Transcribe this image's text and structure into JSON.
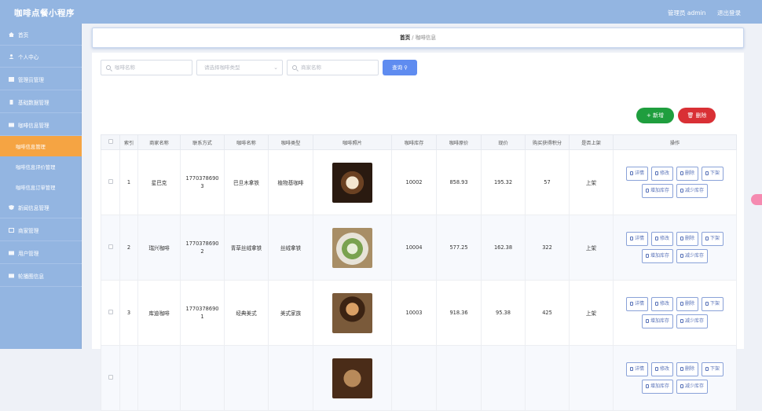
{
  "app": {
    "title": "咖啡点餐小程序",
    "admin": "管理员 admin",
    "logout": "退出登录"
  },
  "sidebar": {
    "items": [
      {
        "label": "首页"
      },
      {
        "label": "个人中心"
      },
      {
        "label": "管理员管理"
      },
      {
        "label": "基础数据管理"
      },
      {
        "label": "咖啡信息管理"
      }
    ],
    "subitems": [
      {
        "label": "咖啡信息管理",
        "active": true
      },
      {
        "label": "咖啡信息评价管理"
      },
      {
        "label": "咖啡信息订单管理"
      }
    ],
    "items2": [
      {
        "label": "新闻信息管理"
      },
      {
        "label": "商家管理"
      },
      {
        "label": "用户管理"
      },
      {
        "label": "轮播图信息"
      }
    ]
  },
  "breadcrumb": {
    "home": "首页",
    "sep": "/",
    "current": "咖啡信息"
  },
  "search": {
    "name_placeholder": "咖啡名称",
    "type_placeholder": "请选择咖啡类型",
    "shop_placeholder": "商家名称",
    "button": "查询"
  },
  "actions": {
    "add": "新增",
    "delete": "删除"
  },
  "table": {
    "headers": [
      "",
      "索引",
      "商家名称",
      "联系方式",
      "咖啡名称",
      "咖啡类型",
      "咖啡照片",
      "咖啡库存",
      "咖啡原价",
      "现价",
      "购买获得积分",
      "是否上架",
      "操作"
    ],
    "op_labels": {
      "detail": "详情",
      "edit": "修改",
      "delete": "删除",
      "down": "下架",
      "add_stock": "增加库存",
      "reduce_stock": "减少库存"
    },
    "rows": [
      {
        "index": "1",
        "shop": "星巴克",
        "phone": "17703786903",
        "name": "巴旦木拿铁",
        "type": "植物基咖啡",
        "stock": "10002",
        "orig": "858.93",
        "price": "195.32",
        "points": "57",
        "status": "上架"
      },
      {
        "index": "2",
        "shop": "瑞兴咖啡",
        "phone": "17703786902",
        "name": "青草丝绒拿铁",
        "type": "丝绒拿铁",
        "stock": "10004",
        "orig": "577.25",
        "price": "162.38",
        "points": "322",
        "status": "上架"
      },
      {
        "index": "3",
        "shop": "库迪咖啡",
        "phone": "17703786901",
        "name": "经典美式",
        "type": "美式家族",
        "stock": "10003",
        "orig": "918.36",
        "price": "95.38",
        "points": "425",
        "status": "上架"
      },
      {
        "index": "",
        "shop": "",
        "phone": "",
        "name": "",
        "type": "",
        "stock": "",
        "orig": "",
        "price": "",
        "points": "",
        "status": ""
      }
    ]
  },
  "colors": {
    "topbar": "#93b5e1",
    "active": "#f5a443",
    "primary": "#5f8cf0",
    "success": "#1f9e3e",
    "danger": "#d93035"
  }
}
